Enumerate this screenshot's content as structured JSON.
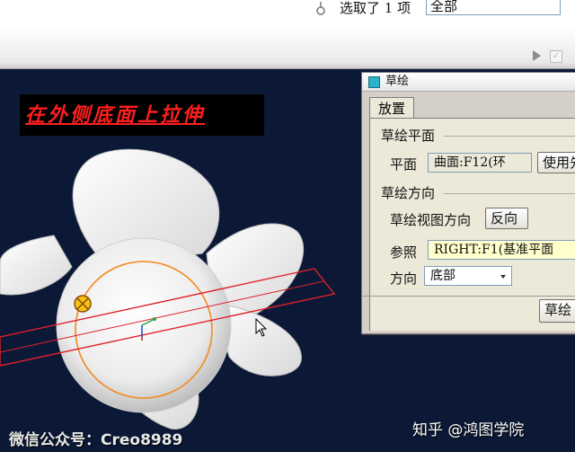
{
  "status": {
    "message": "选取了 1 项",
    "filter_value": "全部"
  },
  "caption": "在外侧底面上拉伸",
  "dialog": {
    "title": "草绘",
    "tab_label": "放置",
    "sketch_plane_group": "草绘平面",
    "plane_label": "平面",
    "plane_value": "曲面:F12(环",
    "use_previous_button": "使用先",
    "orientation_group": "草绘方向",
    "view_direction_label": "草绘视图方向",
    "flip_button": "反向",
    "reference_label": "参照",
    "reference_value": "RIGHT:F1(基准平面",
    "direction_label": "方向",
    "direction_value": "底部",
    "sketch_button": "草绘"
  },
  "watermarks": {
    "left": "微信公众号：Creo8989",
    "right": "知乎 @鸿图学院"
  },
  "colors": {
    "viewport_bg": "#0b1937",
    "caption_text": "#ff1e1e",
    "plane_outline": "#e0202a",
    "circle_edge": "#f28a1e",
    "reference_field_bg": "#ffffcc"
  }
}
